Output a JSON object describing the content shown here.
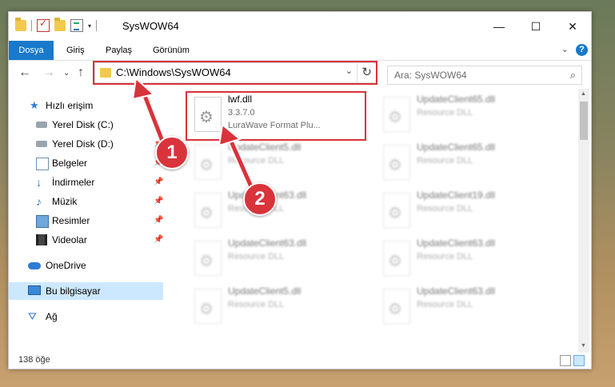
{
  "window": {
    "title": "SysWOW64",
    "controls": {
      "minimize": "—",
      "maximize": "☐",
      "close": "✕"
    }
  },
  "ribbon": {
    "tabs": [
      "Dosya",
      "Giriş",
      "Paylaş",
      "Görünüm"
    ],
    "help": "?",
    "collapse": "⌄"
  },
  "nav": {
    "back": "←",
    "forward": "→",
    "recent": "⌄",
    "up": "↑",
    "address": "C:\\Windows\\SysWOW64",
    "address_dropdown": "⌄",
    "refresh": "↻",
    "search_placeholder": "Ara: SysWOW64",
    "search_icon": "⌕"
  },
  "sidebar": {
    "items": [
      {
        "label": "Hızlı erişim",
        "icon": "star-icon",
        "glyph": "★",
        "pinned": false
      },
      {
        "label": "Yerel Disk (C:)",
        "icon": "drive-icon",
        "glyph": "",
        "pinned": false
      },
      {
        "label": "Yerel Disk (D:)",
        "icon": "drive-icon",
        "glyph": "",
        "pinned": true
      },
      {
        "label": "Belgeler",
        "icon": "documents-icon",
        "glyph": "",
        "pinned": true
      },
      {
        "label": "İndirmeler",
        "icon": "download-icon",
        "glyph": "↓",
        "pinned": true
      },
      {
        "label": "Müzik",
        "icon": "music-icon",
        "glyph": "♪",
        "pinned": true
      },
      {
        "label": "Resimler",
        "icon": "pictures-icon",
        "glyph": "",
        "pinned": true
      },
      {
        "label": "Videolar",
        "icon": "videos-icon",
        "glyph": "",
        "pinned": true
      },
      {
        "label": "OneDrive",
        "icon": "onedrive-icon",
        "glyph": "",
        "pinned": false
      },
      {
        "label": "Bu bilgisayar",
        "icon": "computer-icon",
        "glyph": "",
        "pinned": false,
        "selected": true
      },
      {
        "label": "Ağ",
        "icon": "network-icon",
        "glyph": "⛛",
        "pinned": false
      }
    ],
    "pin_glyph": "📌"
  },
  "files": {
    "selected": {
      "name": "lwf.dll",
      "version": "3.3.7.0",
      "description": "LuraWave Format Plu..."
    },
    "right_column": [
      {
        "name": "UpdateClient65.dll",
        "type": "Resource DLL"
      },
      {
        "name": "UpdateClient65.dll",
        "type": "Resource DLL"
      },
      {
        "name": "UpdateClient19.dll",
        "type": "Resource DLL"
      },
      {
        "name": "UpdateClient63.dll",
        "type": "Resource DLL"
      },
      {
        "name": "UpdateClient63.dll",
        "type": "Resource DLL"
      }
    ],
    "left_column": [
      {
        "name": "UpdateClient5.dll",
        "type": "Resource DLL"
      },
      {
        "name": "UpdateClient63.dll",
        "type": "Resource DLL"
      },
      {
        "name": "UpdateClient63.dll",
        "type": "Resource DLL"
      },
      {
        "name": "UpdateClient5.dll",
        "type": "Resource DLL"
      }
    ]
  },
  "status": {
    "item_count": "138 öğe"
  },
  "annotations": {
    "step1": "1",
    "step2": "2",
    "color": "#d9333b"
  }
}
